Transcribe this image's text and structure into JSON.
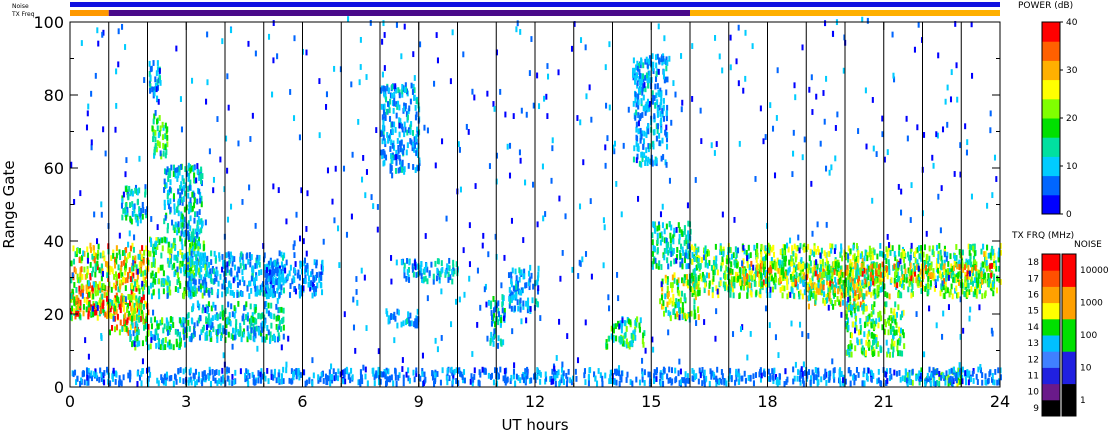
{
  "chart_data": {
    "type": "heatmap",
    "xlabel": "UT hours",
    "ylabel": "Range Gate",
    "xlim": [
      0,
      24
    ],
    "ylim": [
      0,
      100
    ],
    "x_ticks": [
      0,
      3,
      6,
      9,
      12,
      15,
      18,
      21,
      24
    ],
    "y_ticks": [
      0,
      20,
      40,
      60,
      80,
      100
    ],
    "x_tick_labels": [
      "0",
      "3",
      "6",
      "9",
      "12",
      "15",
      "18",
      "21",
      "24"
    ],
    "y_tick_labels": [
      "0",
      "20",
      "40",
      "60",
      "80",
      "100"
    ],
    "scan_boundaries_hours": [
      1,
      2,
      3,
      4,
      5,
      6,
      7,
      8,
      9,
      10,
      11,
      12,
      13,
      14,
      15,
      16,
      17,
      18,
      19,
      20,
      21,
      22,
      23
    ],
    "status_bars": {
      "noise_label": "Noise",
      "txfreq_label": "TX Freq",
      "noise_color": "#1010e0",
      "txfreq_segments": [
        {
          "start": 0,
          "end": 1.0,
          "color": "#ff9900"
        },
        {
          "start": 1.0,
          "end": 16.0,
          "color": "#4a0a8a"
        },
        {
          "start": 16.0,
          "end": 24,
          "color": "#ffb000"
        }
      ]
    },
    "power_colorbar": {
      "label": "POWER (dB)",
      "ticks": [
        "0",
        "10",
        "20",
        "30",
        "40"
      ],
      "colors": [
        "#0000ff",
        "#0066ff",
        "#00ccff",
        "#00e0a0",
        "#00e000",
        "#80ff00",
        "#ffff00",
        "#ffb000",
        "#ff6000",
        "#ff0000"
      ]
    },
    "txfreq_scale": {
      "label": "TX FRQ (MHz)",
      "ticks": [
        "9",
        "10",
        "11",
        "12",
        "13",
        "14",
        "15",
        "16",
        "17",
        "18"
      ],
      "colors": [
        "#000000",
        "#6a1a8a",
        "#2020e0",
        "#4080ff",
        "#00c0ff",
        "#00e000",
        "#ffff00",
        "#ffa000",
        "#ff5000",
        "#ff0000"
      ]
    },
    "noise_scale": {
      "label": "NOISE",
      "ticks": [
        "1",
        "10",
        "100",
        "1000",
        "10000"
      ],
      "colors": [
        "#000000",
        "#2020e0",
        "#00e000",
        "#ffa000",
        "#ff0000"
      ]
    },
    "echo_regions": [
      {
        "x0": 0.0,
        "x1": 2.0,
        "y0": 18,
        "y1": 38,
        "level": 0.85
      },
      {
        "x0": 0.0,
        "x1": 1.0,
        "y0": 19,
        "y1": 27,
        "level": 1.0
      },
      {
        "x0": 1.0,
        "x1": 2.0,
        "y0": 14,
        "y1": 24,
        "level": 0.95
      },
      {
        "x0": 1.5,
        "x1": 3.0,
        "y0": 10,
        "y1": 18,
        "level": 0.5
      },
      {
        "x0": 2.0,
        "x1": 3.5,
        "y0": 24,
        "y1": 40,
        "level": 0.55
      },
      {
        "x0": 2.4,
        "x1": 3.4,
        "y0": 40,
        "y1": 60,
        "level": 0.4
      },
      {
        "x0": 1.3,
        "x1": 2.0,
        "y0": 44,
        "y1": 54,
        "level": 0.4
      },
      {
        "x0": 2.1,
        "x1": 2.5,
        "y0": 62,
        "y1": 74,
        "level": 0.55
      },
      {
        "x0": 2.0,
        "x1": 2.3,
        "y0": 78,
        "y1": 88,
        "level": 0.35
      },
      {
        "x0": 3.0,
        "x1": 5.5,
        "y0": 12,
        "y1": 22,
        "level": 0.4
      },
      {
        "x0": 3.0,
        "x1": 5.5,
        "y0": 24,
        "y1": 36,
        "level": 0.3
      },
      {
        "x0": 5.0,
        "x1": 6.5,
        "y0": 24,
        "y1": 34,
        "level": 0.25
      },
      {
        "x0": 8.0,
        "x1": 9.0,
        "y0": 58,
        "y1": 82,
        "level": 0.3
      },
      {
        "x0": 8.0,
        "x1": 9.0,
        "y0": 16,
        "y1": 20,
        "level": 0.3
      },
      {
        "x0": 8.5,
        "x1": 10.0,
        "y0": 28,
        "y1": 34,
        "level": 0.35
      },
      {
        "x0": 10.8,
        "x1": 11.2,
        "y0": 10,
        "y1": 24,
        "level": 0.4
      },
      {
        "x0": 11.3,
        "x1": 12.1,
        "y0": 20,
        "y1": 32,
        "level": 0.3
      },
      {
        "x0": 13.8,
        "x1": 14.8,
        "y0": 10,
        "y1": 18,
        "level": 0.55
      },
      {
        "x0": 14.5,
        "x1": 15.4,
        "y0": 60,
        "y1": 90,
        "level": 0.3
      },
      {
        "x0": 15.2,
        "x1": 16.2,
        "y0": 18,
        "y1": 30,
        "level": 0.7
      },
      {
        "x0": 15.0,
        "x1": 16.0,
        "y0": 32,
        "y1": 44,
        "level": 0.45
      },
      {
        "x0": 16.0,
        "x1": 24.0,
        "y0": 24,
        "y1": 38,
        "level": 0.65
      },
      {
        "x0": 17.0,
        "x1": 23.8,
        "y0": 27,
        "y1": 33,
        "level": 0.85
      },
      {
        "x0": 19.0,
        "x1": 20.5,
        "y0": 21,
        "y1": 27,
        "level": 0.8
      },
      {
        "x0": 20.0,
        "x1": 21.5,
        "y0": 8,
        "y1": 22,
        "level": 0.6
      },
      {
        "x0": 21.5,
        "x1": 23.2,
        "y0": 0,
        "y1": 4,
        "level": 0.55
      },
      {
        "x0": 0.0,
        "x1": 24.0,
        "y0": 0,
        "y1": 4,
        "level": 0.25
      }
    ]
  }
}
